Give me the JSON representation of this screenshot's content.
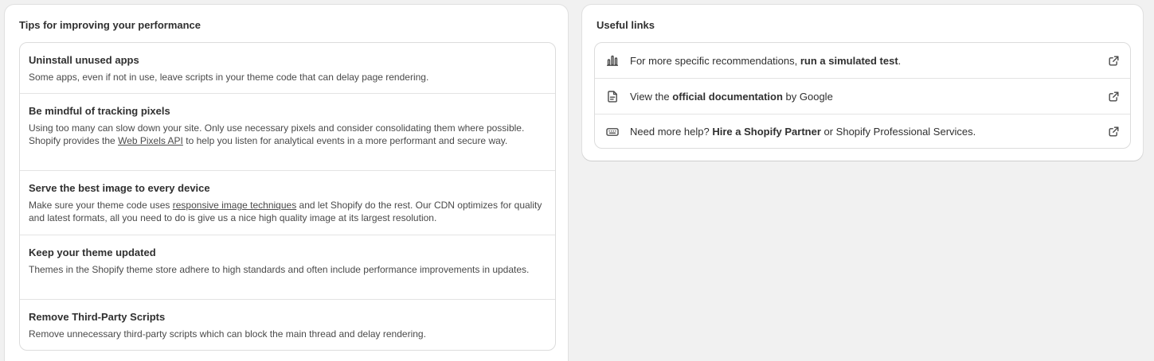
{
  "tips": {
    "title": "Tips for improving your performance",
    "items": [
      {
        "title": "Uninstall unused apps",
        "desc": "Some apps, even if not in use, leave scripts in your theme code that can delay page rendering."
      },
      {
        "title": "Be mindful of tracking pixels",
        "desc_before": "Using too many can slow down your site. Only use necessary pixels and consider consolidating them where possible. Shopify provides the ",
        "link": "Web Pixels API",
        "desc_after": " to help you listen for analytical events in a more performant and secure way."
      },
      {
        "title": "Serve the best image to every device",
        "desc_before": "Make sure your theme code uses ",
        "link": "responsive image techniques",
        "desc_after": " and let Shopify do the rest. Our CDN optimizes for quality and latest formats, all you need to do is give us a nice high quality image at its largest resolution."
      },
      {
        "title": "Keep your theme updated",
        "desc": "Themes in the Shopify theme store adhere to high standards and often include performance improvements in updates."
      },
      {
        "title": "Remove Third-Party Scripts",
        "desc": "Remove unnecessary third-party scripts which can block the main thread and delay rendering."
      }
    ]
  },
  "links": {
    "title": "Useful links",
    "items": [
      {
        "icon": "bar-chart-icon",
        "before": "For more specific recommendations, ",
        "bold": "run a simulated test",
        "after": "."
      },
      {
        "icon": "document-icon",
        "before": "View the ",
        "bold": "official documentation",
        "after": " by Google"
      },
      {
        "icon": "keyboard-icon",
        "before": "Need more help? ",
        "bold": "Hire a Shopify Partner",
        "after": " or Shopify Professional Services."
      }
    ]
  },
  "colors": {
    "background": "#f1f1f1",
    "card": "#ffffff",
    "text": "#303030",
    "muted_text": "#4a4a4a",
    "border": "#dcdcdc"
  }
}
